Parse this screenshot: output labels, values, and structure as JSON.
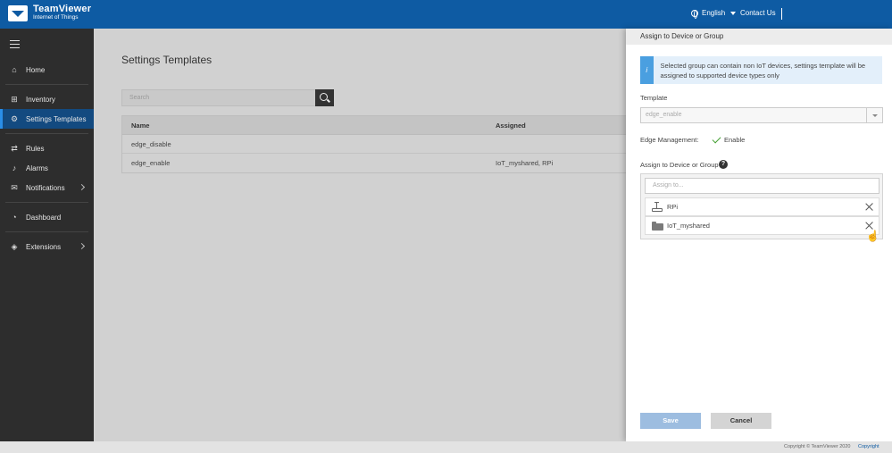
{
  "header": {
    "logo_main": "TeamViewer",
    "logo_sub": "Internet of Things",
    "language": "English",
    "contact": "Contact Us"
  },
  "sidebar": {
    "items": [
      {
        "label": "Home",
        "icon": "home-icon"
      },
      {
        "label": "Inventory",
        "icon": "inventory-icon"
      },
      {
        "label": "Settings Templates",
        "icon": "settings-icon",
        "active": true
      },
      {
        "label": "Rules",
        "icon": "rules-icon"
      },
      {
        "label": "Alarms",
        "icon": "bell-icon"
      },
      {
        "label": "Notifications",
        "icon": "envelope-icon"
      },
      {
        "label": "Dashboard",
        "icon": "dashboard-icon"
      },
      {
        "label": "Extensions",
        "icon": "extensions-icon"
      }
    ]
  },
  "main": {
    "title": "Settings Templates",
    "search_placeholder": "Search",
    "table": {
      "columns": [
        "Name",
        "Assigned"
      ],
      "rows": [
        {
          "name": "edge_disable",
          "assigned": ""
        },
        {
          "name": "edge_enable",
          "assigned": "IoT_myshared, RPi"
        }
      ]
    }
  },
  "panel": {
    "title": "Assign to Device or Group",
    "info_text": "Selected group can contain non IoT devices, settings template will be assigned to supported device types only",
    "template_label": "Template",
    "template_value": "edge_enable",
    "edge_label": "Edge Management:",
    "edge_value": "Enable",
    "assign_label": "Assign to Device or Group",
    "assign_placeholder": "Assign to...",
    "assigned_items": [
      {
        "label": "RPi",
        "icon": "device-icon"
      },
      {
        "label": "IoT_myshared",
        "icon": "folder-icon"
      }
    ],
    "save_label": "Save",
    "cancel_label": "Cancel"
  },
  "footer": {
    "copyright": "Copyright © TeamViewer 2020",
    "link": "Copyright"
  },
  "colors": {
    "brand": "#0e5ba3",
    "sidebar_bg": "#2d2d2d",
    "active_item": "#134a80",
    "info_accent": "#4a9fe0",
    "save_button": "#9dbde0"
  }
}
